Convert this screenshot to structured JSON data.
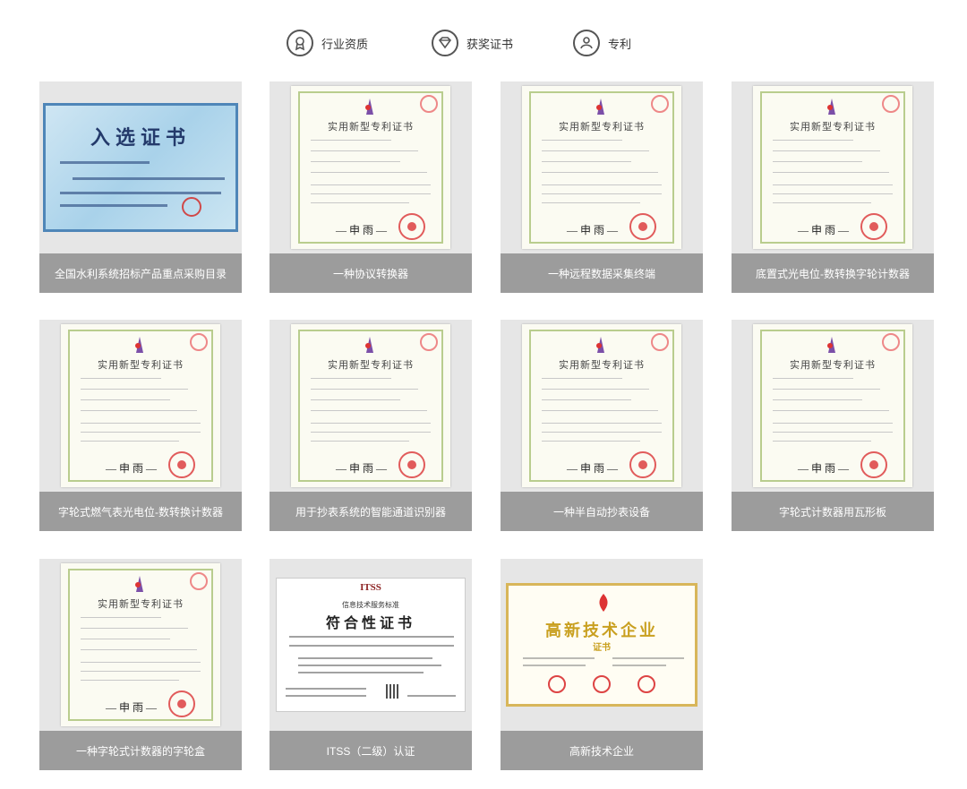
{
  "tabs": [
    {
      "label": "行业资质",
      "icon": "award-medal-icon"
    },
    {
      "label": "获奖证书",
      "icon": "diamond-trophy-icon"
    },
    {
      "label": "专利",
      "icon": "patent-person-icon"
    }
  ],
  "certificates": [
    {
      "caption": "全国水利系统招标产品重点采购目录",
      "kind": "blue",
      "image_text": "入选证书"
    },
    {
      "caption": "一种协议转换器",
      "kind": "patent",
      "image_text": "实用新型专利证书"
    },
    {
      "caption": "一种远程数据采集终端",
      "kind": "patent",
      "image_text": "实用新型专利证书"
    },
    {
      "caption": "底置式光电位-数转换字轮计数器",
      "kind": "patent",
      "image_text": "实用新型专利证书"
    },
    {
      "caption": "字轮式燃气表光电位-数转换计数器",
      "kind": "patent",
      "image_text": "实用新型专利证书"
    },
    {
      "caption": "用于抄表系统的智能通道识别器",
      "kind": "patent",
      "image_text": "实用新型专利证书"
    },
    {
      "caption": "一种半自动抄表设备",
      "kind": "patent",
      "image_text": "实用新型专利证书"
    },
    {
      "caption": "字轮式计数器用瓦形板",
      "kind": "patent",
      "image_text": "实用新型专利证书"
    },
    {
      "caption": "一种字轮式计数器的字轮盒",
      "kind": "patent",
      "image_text": "实用新型专利证书"
    },
    {
      "caption": "ITSS（二级）认证",
      "kind": "itss",
      "image_text": "符合性证书",
      "brand": "ITSS",
      "standard": "信息技术服务标准"
    },
    {
      "caption": "高新技术企业",
      "kind": "hightech",
      "image_text": "高新技术企业",
      "sub": "证书"
    }
  ],
  "colors": {
    "card_bg": "#e6e6e6",
    "caption_bg": "#9c9c9c",
    "caption_text": "#ffffff",
    "tab_text": "#333333"
  }
}
